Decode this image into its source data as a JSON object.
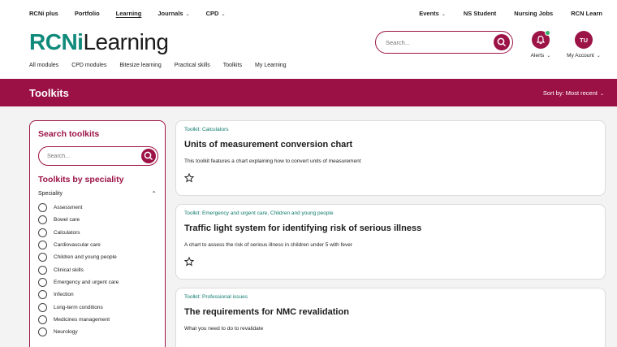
{
  "topbar": {
    "links": [
      "RCNi plus",
      "Portfolio",
      "Learning",
      "Journals",
      "CPD"
    ],
    "right": [
      "Events",
      "NS Student",
      "Nursing Jobs",
      "RCN Learn"
    ]
  },
  "header": {
    "logo_part1": "RCNi",
    "logo_part2": "Learning",
    "search_placeholder": "Search...",
    "alerts_label": "Alerts",
    "account_initials": "TU",
    "account_label": "My Account"
  },
  "mainnav": [
    "All modules",
    "CPD modules",
    "Bitesize learning",
    "Practical skills",
    "Toolkits",
    "My Learning"
  ],
  "banner": {
    "title": "Toolkits",
    "sort": "Sort by: Most recent"
  },
  "filters": {
    "search_title": "Search toolkits",
    "search_placeholder": "Search...",
    "speciality_title": "Toolkits by speciality",
    "speciality_label": "Speciality",
    "options": [
      "Assessment",
      "Bowel care",
      "Calculators",
      "Cardiovascular care",
      "Children and young people",
      "Clinical skills",
      "Emergency and urgent care",
      "Infection",
      "Long-term conditions",
      "Medicines management",
      "Neurology"
    ]
  },
  "cards": [
    {
      "category": "Toolkit: Calculators",
      "title": "Units of measurement conversion chart",
      "description": "This toolkit features a chart explaining how to convert units of measurement"
    },
    {
      "category": "Toolkit: Emergency and urgent care, Children and young people",
      "title": "Traffic light system for identifying risk of serious illness",
      "description": "A chart to assess the risk of serious illness in children under 5 with fever"
    },
    {
      "category": "Toolkit: Professional issues",
      "title": "The requirements for NMC revalidation",
      "description": "What you need to do to revalidate"
    }
  ],
  "colors": {
    "brand": "#9b1145",
    "logo_accent": "#0f8a7a",
    "status_dot": "#2fb36b"
  }
}
